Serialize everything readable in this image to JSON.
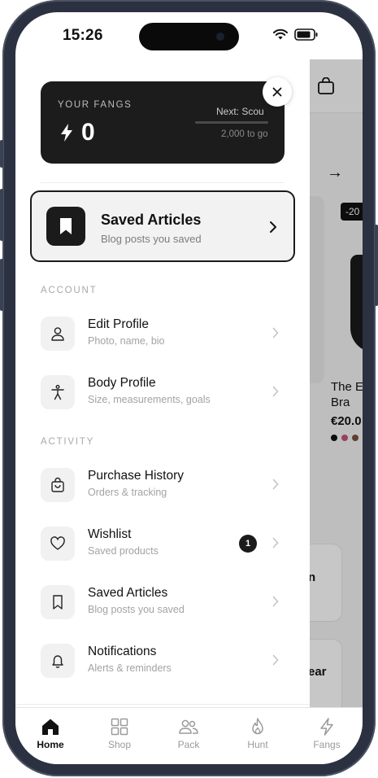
{
  "status_bar": {
    "time": "15:26"
  },
  "fangs_card": {
    "label": "YOUR FANGS",
    "value": "0",
    "next_label": "Next: Scou",
    "to_go": "2,000 to go",
    "progress": 0
  },
  "highlight_card": {
    "title": "Saved Articles",
    "subtitle": "Blog posts you saved"
  },
  "sections": {
    "account": {
      "label": "ACCOUNT",
      "items": [
        {
          "title": "Edit Profile",
          "subtitle": "Photo, name, bio",
          "icon": "user-icon"
        },
        {
          "title": "Body Profile",
          "subtitle": "Size, measurements, goals",
          "icon": "body-icon"
        }
      ]
    },
    "activity": {
      "label": "ACTIVITY",
      "items": [
        {
          "title": "Purchase History",
          "subtitle": "Orders & tracking",
          "icon": "shopping-bag-icon"
        },
        {
          "title": "Wishlist",
          "subtitle": "Saved products",
          "icon": "heart-icon",
          "badge": "1"
        },
        {
          "title": "Saved Articles",
          "subtitle": "Blog posts you saved",
          "icon": "bookmark-icon"
        },
        {
          "title": "Notifications",
          "subtitle": "Alerts & reminders",
          "icon": "bell-icon"
        }
      ]
    }
  },
  "background_page": {
    "discount": "-20",
    "product_title": "The E Bra",
    "price": "€20.0",
    "card2_text": "n",
    "card3_text": "ear",
    "swatch_colors": [
      "#111111",
      "#c2557a",
      "#7a5040",
      "#b08060"
    ]
  },
  "tabbar": {
    "tabs": [
      {
        "label": "Home",
        "active": true
      },
      {
        "label": "Shop",
        "active": false
      },
      {
        "label": "Pack",
        "active": false
      },
      {
        "label": "Hunt",
        "active": false
      },
      {
        "label": "Fangs",
        "active": false
      }
    ]
  }
}
